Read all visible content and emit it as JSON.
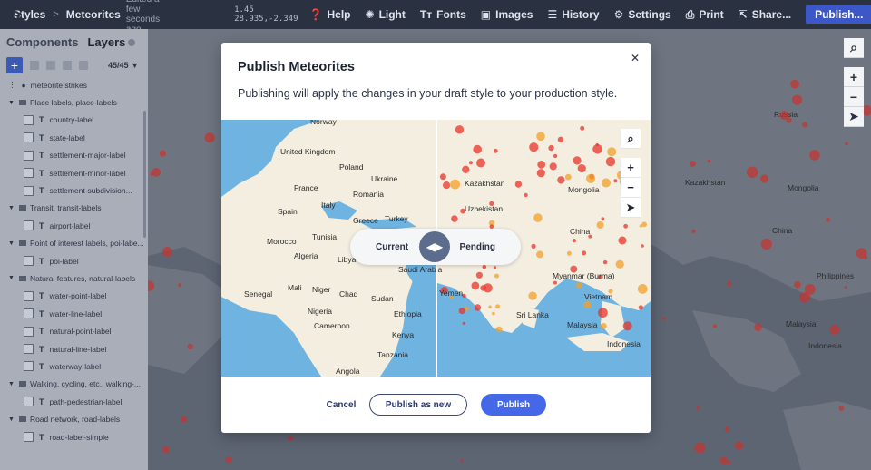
{
  "topbar": {
    "breadcrumb": [
      "Styles",
      "Meteorites"
    ],
    "edited": "Edited a few seconds ago",
    "coords": "1.45 28.935,-2.349",
    "items": [
      {
        "icon": "help-icon",
        "label": "Help"
      },
      {
        "icon": "light-icon",
        "label": "Light"
      },
      {
        "icon": "fonts-icon",
        "label": "Fonts"
      },
      {
        "icon": "images-icon",
        "label": "Images"
      },
      {
        "icon": "history-icon",
        "label": "History"
      },
      {
        "icon": "settings-icon",
        "label": "Settings"
      },
      {
        "icon": "print-icon",
        "label": "Print"
      },
      {
        "icon": "share-icon",
        "label": "Share..."
      }
    ],
    "publish_label": "Publish..."
  },
  "panel": {
    "tabs": [
      "Components",
      "Layers"
    ],
    "layer_count": "45/45",
    "layers": [
      {
        "type": "special",
        "label": "meteorite strikes"
      },
      {
        "type": "group",
        "label": "Place labels, place-labels"
      },
      {
        "type": "item",
        "label": "country-label"
      },
      {
        "type": "item",
        "label": "state-label"
      },
      {
        "type": "item",
        "label": "settlement-major-label"
      },
      {
        "type": "item",
        "label": "settlement-minor-label"
      },
      {
        "type": "item",
        "label": "settlement-subdivision..."
      },
      {
        "type": "group",
        "label": "Transit, transit-labels"
      },
      {
        "type": "item",
        "label": "airport-label"
      },
      {
        "type": "group",
        "label": "Point of interest labels, poi-labe..."
      },
      {
        "type": "item",
        "label": "poi-label"
      },
      {
        "type": "group",
        "label": "Natural features, natural-labels"
      },
      {
        "type": "item",
        "label": "water-point-label"
      },
      {
        "type": "item",
        "label": "water-line-label"
      },
      {
        "type": "item",
        "label": "natural-point-label"
      },
      {
        "type": "item",
        "label": "natural-line-label"
      },
      {
        "type": "item",
        "label": "waterway-label"
      },
      {
        "type": "group",
        "label": "Walking, cycling, etc., walking-..."
      },
      {
        "type": "item",
        "label": "path-pedestrian-label"
      },
      {
        "type": "group",
        "label": "Road network, road-labels"
      },
      {
        "type": "item",
        "label": "road-label-simple"
      }
    ]
  },
  "bg_map_labels": [
    "Russia",
    "Kazakhstan",
    "Mongolia",
    "China",
    "Philippines",
    "Malaysia",
    "Indonesia"
  ],
  "modal": {
    "title": "Publish Meteorites",
    "description": "Publishing will apply the changes in your draft style to your production style.",
    "compare_left": "Current",
    "compare_right": "Pending",
    "cancel_label": "Cancel",
    "publish_new_label": "Publish as new",
    "publish_label": "Publish",
    "left_map_labels": [
      "Norway",
      "United Kingdom",
      "Poland",
      "Ukraine",
      "France",
      "Romania",
      "Spain",
      "Italy",
      "Greece",
      "Turkey",
      "Tunisia",
      "Morocco",
      "Algeria",
      "Libya",
      "Saudi Arabia",
      "Senegal",
      "Mali",
      "Niger",
      "Chad",
      "Sudan",
      "Nigeria",
      "Ethiopia",
      "Cameroon",
      "Kenya",
      "Tanzania",
      "Angola"
    ],
    "right_map_labels": [
      "Kazakhstan",
      "Uzbekistan",
      "Mongolia",
      "China",
      "Yemen",
      "Myanmar (Burma)",
      "Vietnam",
      "Sri Lanka",
      "Malaysia",
      "Indonesia"
    ]
  },
  "colors": {
    "accent": "#4468e8",
    "topbar": "#2a3140",
    "heat": "#e8332a",
    "land": "#f3eedf",
    "water": "#6fb3e0"
  }
}
